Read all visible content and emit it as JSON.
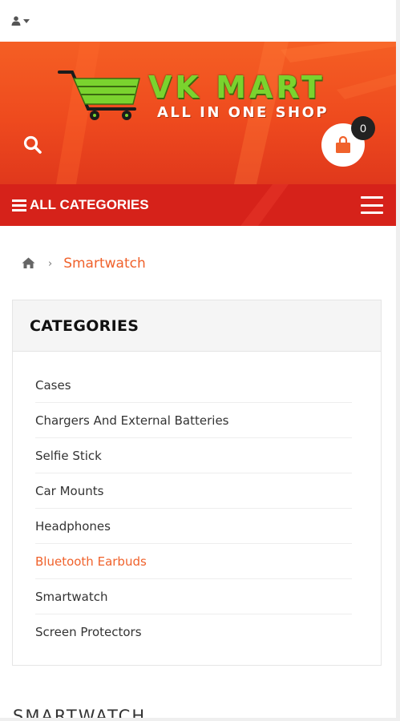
{
  "account": {
    "icon": "user-icon"
  },
  "brand": {
    "name": "VK MART",
    "tagline": "ALL IN ONE SHOP",
    "colors": {
      "name": "#7ad32e",
      "header": "#f2501f",
      "catbar": "#d6221a"
    }
  },
  "cart": {
    "count": "0",
    "icon": "shopping-bag-icon"
  },
  "nav": {
    "all_categories_label": "ALL CATEGORIES"
  },
  "breadcrumb": {
    "current": "Smartwatch"
  },
  "categories": {
    "title": "CATEGORIES",
    "items": [
      {
        "label": "Cases"
      },
      {
        "label": "Chargers And External Batteries"
      },
      {
        "label": "Selfie Stick"
      },
      {
        "label": "Car Mounts"
      },
      {
        "label": "Headphones"
      },
      {
        "label": "Bluetooth Earbuds"
      },
      {
        "label": "Smartwatch"
      },
      {
        "label": "Screen Protectors"
      }
    ],
    "accent_color": "#f0622c"
  },
  "section": {
    "title_peek": "SMARTWATCH"
  }
}
